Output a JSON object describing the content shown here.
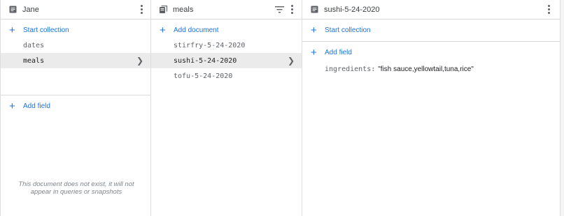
{
  "colors": {
    "accent": "#1a73e8",
    "selected_row": "#ebebeb",
    "border": "#dadce0"
  },
  "panel1": {
    "title": "Jane",
    "icon": "document-icon",
    "start_collection": "Start collection",
    "collections": [
      {
        "label": "dates",
        "selected": false
      },
      {
        "label": "meals",
        "selected": true
      }
    ],
    "add_field": "Add field",
    "empty_note": "This document does not exist, it will not appear in queries or snapshots"
  },
  "panel2": {
    "title": "meals",
    "icon": "collection-icon",
    "add_document": "Add document",
    "documents": [
      {
        "label": "stirfry-5-24-2020",
        "selected": false
      },
      {
        "label": "sushi-5-24-2020",
        "selected": true
      },
      {
        "label": "tofu-5-24-2020",
        "selected": false
      }
    ]
  },
  "panel3": {
    "title": "sushi-5-24-2020",
    "icon": "document-icon",
    "start_collection": "Start collection",
    "add_field": "Add field",
    "fields": [
      {
        "key": "ingredients:",
        "value": "\"fish sauce,yellowtail,tuna,rice\""
      }
    ]
  }
}
